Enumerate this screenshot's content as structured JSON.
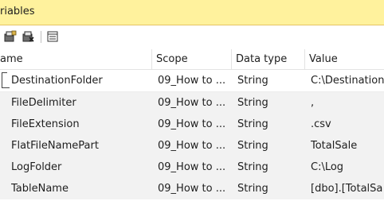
{
  "window": {
    "title": "riables"
  },
  "toolbar": {
    "icons": [
      "add-variable-icon",
      "delete-variable-icon",
      "grid-options-icon"
    ]
  },
  "columns": {
    "name": "ame",
    "scope": "Scope",
    "data_type": "Data type",
    "value": "Value"
  },
  "rows": [
    {
      "name": "DestinationFolder",
      "scope": "09_How to ...",
      "type": "String",
      "value": "C:\\Destination"
    },
    {
      "name": "FileDelimiter",
      "scope": "09_How to ...",
      "type": "String",
      "value": ","
    },
    {
      "name": "FileExtension",
      "scope": "09_How to ...",
      "type": "String",
      "value": ".csv"
    },
    {
      "name": "FlatFileNamePart",
      "scope": "09_How to ...",
      "type": "String",
      "value": "TotalSale"
    },
    {
      "name": "LogFolder",
      "scope": "09_How to ...",
      "type": "String",
      "value": "C:\\Log"
    },
    {
      "name": "TableName",
      "scope": "09_How to ...",
      "type": "String",
      "value": "[dbo].[TotalSa"
    }
  ],
  "colors": {
    "title_bg": "#fff29d",
    "row_bg": "#f2f2f2"
  }
}
